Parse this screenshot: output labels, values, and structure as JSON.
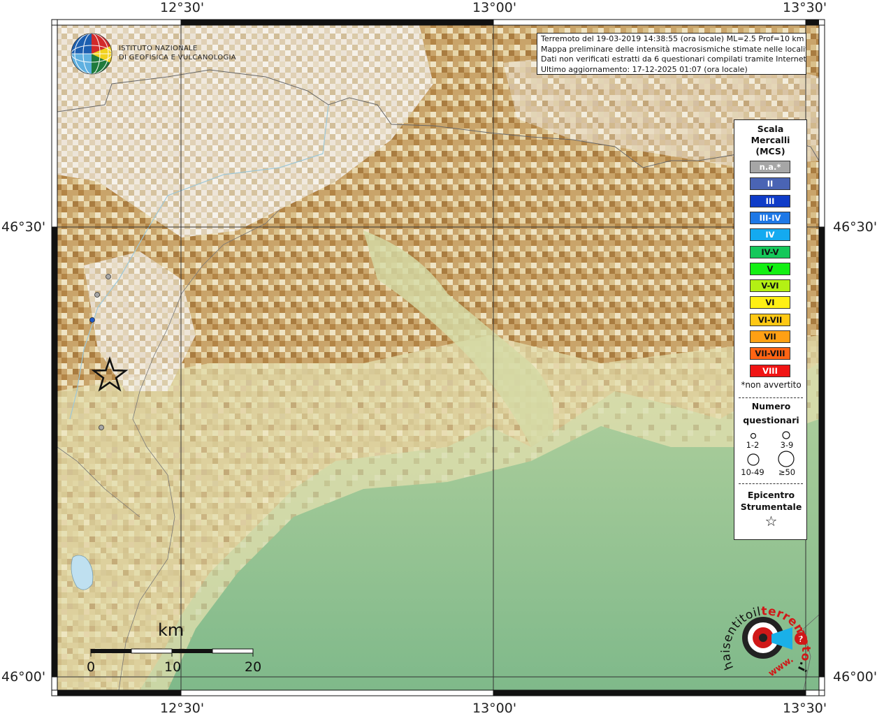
{
  "coords": {
    "top": [
      "12°30'",
      "13°00'",
      "13°30'"
    ],
    "bottom": [
      "12°30'",
      "13°00'",
      "13°30'"
    ],
    "left": [
      "46°30'",
      "46°00'"
    ],
    "right": [
      "46°30'",
      "46°00'"
    ]
  },
  "logo": {
    "line1": "ISTITUTO NAZIONALE",
    "line2": "DI GEOFISICA E VULCANOLOGIA"
  },
  "info": {
    "line1": "Terremoto del 19-03-2019 14:38:55 (ora locale) ML=2.5 Prof=10 km",
    "line2": "Mappa preliminare delle intensità macrosismiche stimate nelle località",
    "line3": "Dati non verificati estratti da 6 questionari compilati tramite Internet.",
    "line4": "Ultimo aggiornamento: 17-12-2025 01:07 (ora locale)"
  },
  "legend": {
    "title1": "Scala",
    "title2": "Mercalli",
    "title3": "(MCS)",
    "levels": [
      {
        "label": "n.a.*",
        "color": "#a6a6a6",
        "text": "#ffffff"
      },
      {
        "label": "II",
        "color": "#4a64b4",
        "text": "#ffffff"
      },
      {
        "label": "III",
        "color": "#0f3cc8",
        "text": "#ffffff"
      },
      {
        "label": "III-IV",
        "color": "#1e78e6",
        "text": "#ffffff"
      },
      {
        "label": "IV",
        "color": "#14aaf0",
        "text": "#ffffff"
      },
      {
        "label": "IV-V",
        "color": "#14c85a",
        "text": "#111111"
      },
      {
        "label": "V",
        "color": "#14f014",
        "text": "#111111"
      },
      {
        "label": "V-VI",
        "color": "#b4f014",
        "text": "#111111"
      },
      {
        "label": "VI",
        "color": "#fff014",
        "text": "#111111"
      },
      {
        "label": "VI-VII",
        "color": "#ffc814",
        "text": "#111111"
      },
      {
        "label": "VII",
        "color": "#ffa014",
        "text": "#111111"
      },
      {
        "label": "VII-VIII",
        "color": "#ff6414",
        "text": "#111111"
      },
      {
        "label": "VIII",
        "color": "#f01414",
        "text": "#ffffff"
      }
    ],
    "note": "*non avvertito",
    "count_title1": "Numero",
    "count_title2": "questionari",
    "count_labels": [
      "1-2",
      "3-9",
      "10-49",
      "≥50"
    ],
    "epi_title1": "Epicentro",
    "epi_title2": "Strumentale",
    "epi_symbol": "☆"
  },
  "scalebar": {
    "unit": "km",
    "labels": [
      "0",
      "10",
      "20"
    ]
  },
  "watermark": {
    "text": "www.haisentitoilterremoto.it",
    "part1": "haisentitoil",
    "part2": "terremoto",
    "part3": ".it",
    "part4": "www."
  },
  "colors": {
    "frame": "#111111",
    "grid": "#333333",
    "ocean": "#bfe0f0",
    "epicenter": "#111111"
  }
}
